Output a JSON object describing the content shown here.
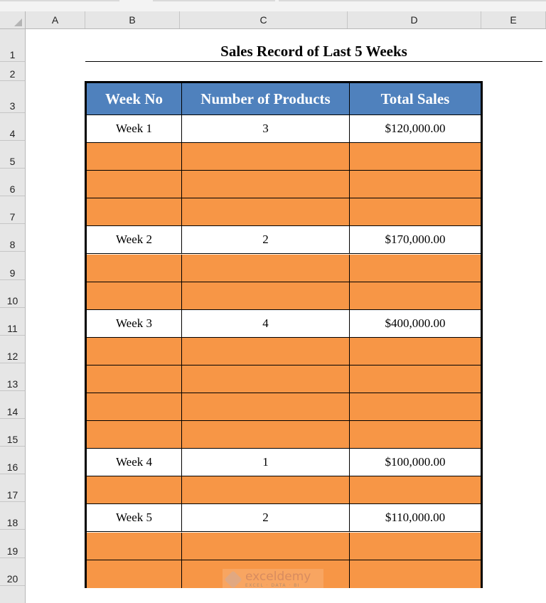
{
  "spreadsheet": {
    "columns": [
      "A",
      "B",
      "C",
      "D",
      "E"
    ],
    "rows": [
      "1",
      "2",
      "3",
      "4",
      "5",
      "6",
      "7",
      "8",
      "9",
      "10",
      "11",
      "12",
      "13",
      "14",
      "15",
      "16",
      "17",
      "18",
      "19",
      "20"
    ]
  },
  "title": "Sales Record of Last 5 Weeks",
  "table": {
    "headers": [
      "Week No",
      "Number of Products",
      "Total Sales"
    ],
    "rows": [
      {
        "row": 4,
        "type": "data",
        "cells": [
          "Week 1",
          "3",
          "$120,000.00"
        ]
      },
      {
        "row": 5,
        "type": "blank",
        "cells": [
          "",
          "",
          ""
        ]
      },
      {
        "row": 6,
        "type": "blank",
        "cells": [
          "",
          "",
          ""
        ]
      },
      {
        "row": 7,
        "type": "blank",
        "cells": [
          "",
          "",
          ""
        ]
      },
      {
        "row": 8,
        "type": "data",
        "cells": [
          "Week 2",
          "2",
          "$170,000.00"
        ]
      },
      {
        "row": 9,
        "type": "blank",
        "cells": [
          "",
          "",
          ""
        ]
      },
      {
        "row": 10,
        "type": "blank",
        "cells": [
          "",
          "",
          ""
        ]
      },
      {
        "row": 11,
        "type": "data",
        "cells": [
          "Week 3",
          "4",
          "$400,000.00"
        ]
      },
      {
        "row": 12,
        "type": "blank",
        "cells": [
          "",
          "",
          ""
        ]
      },
      {
        "row": 13,
        "type": "blank",
        "cells": [
          "",
          "",
          ""
        ]
      },
      {
        "row": 14,
        "type": "blank",
        "cells": [
          "",
          "",
          ""
        ]
      },
      {
        "row": 15,
        "type": "blank",
        "cells": [
          "",
          "",
          ""
        ]
      },
      {
        "row": 16,
        "type": "data",
        "cells": [
          "Week 4",
          "1",
          "$100,000.00"
        ]
      },
      {
        "row": 17,
        "type": "blank",
        "cells": [
          "",
          "",
          ""
        ]
      },
      {
        "row": 18,
        "type": "data",
        "cells": [
          "Week 5",
          "2",
          "$110,000.00"
        ]
      },
      {
        "row": 19,
        "type": "blank",
        "cells": [
          "",
          "",
          ""
        ]
      },
      {
        "row": 20,
        "type": "blank",
        "cells": [
          "",
          "",
          ""
        ]
      }
    ]
  },
  "colors": {
    "header_fill": "#4f81bd",
    "blank_row_fill": "#f79646",
    "data_row_fill": "#ffffff"
  },
  "watermark": {
    "name": "exceldemy",
    "tagline": "EXCEL · DATA · BI",
    "icon": "exceldemy-logo-icon"
  }
}
